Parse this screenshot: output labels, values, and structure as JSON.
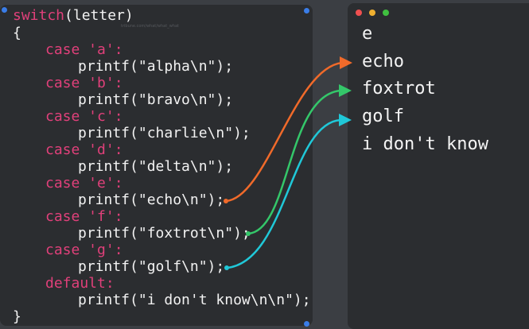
{
  "code": {
    "switch_kw": "switch",
    "switch_arg": "(letter)",
    "open_brace": "{",
    "close_brace": "}",
    "cases": [
      {
        "label": "case 'a':",
        "body": "printf(\"alpha\\n\");"
      },
      {
        "label": "case 'b':",
        "body": "printf(\"bravo\\n\");"
      },
      {
        "label": "case 'c':",
        "body": "printf(\"charlie\\n\");"
      },
      {
        "label": "case 'd':",
        "body": "printf(\"delta\\n\");"
      },
      {
        "label": "case 'e':",
        "body": "printf(\"echo\\n\");"
      },
      {
        "label": "case 'f':",
        "body": "printf(\"foxtrot\\n\");"
      },
      {
        "label": "case 'g':",
        "body": "printf(\"golf\\n\");"
      }
    ],
    "default_label": "default:",
    "default_body": "printf(\"i don't know\\n\\n\");",
    "watermark": "tribune.com/what/what_what"
  },
  "output": {
    "lines": [
      "e",
      "echo",
      "foxtrot",
      "golf",
      "i don't know"
    ]
  },
  "colors": {
    "keyword": "#e0407a",
    "arrow_echo": "#f06a2a",
    "arrow_foxtrot": "#34c76a",
    "arrow_golf": "#20c8d8",
    "window_red": "#f05050",
    "window_yellow": "#f0b030",
    "window_green": "#40c040",
    "corner_dot": "#3a7de8"
  }
}
